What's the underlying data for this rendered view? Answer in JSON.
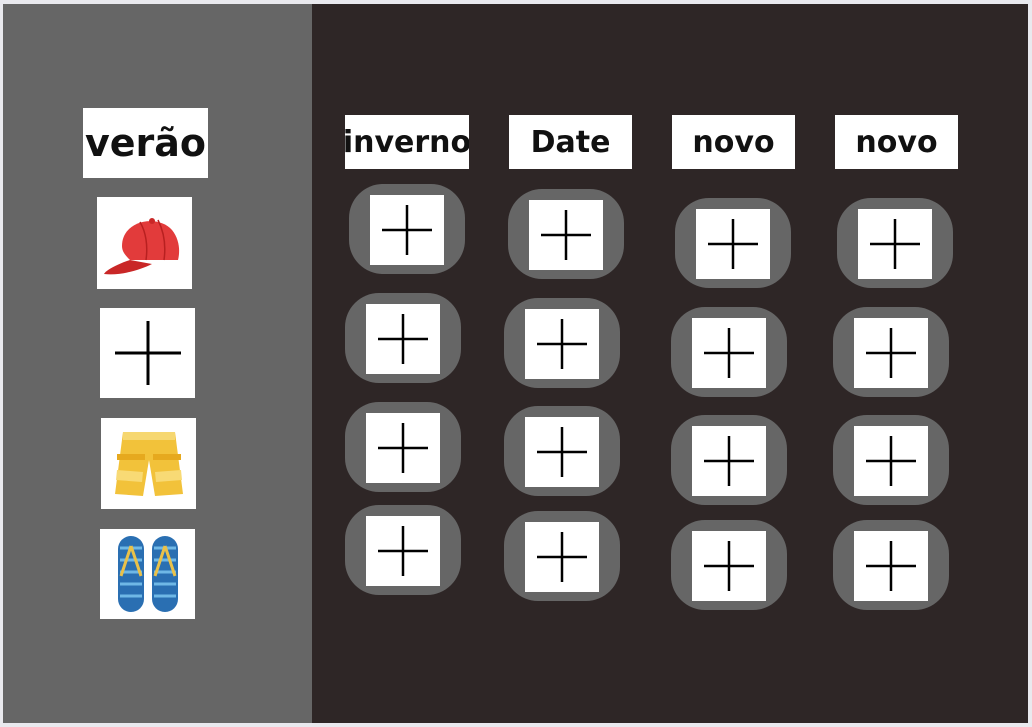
{
  "left_column": {
    "title": "verão",
    "items": [
      {
        "icon": "red-cap-icon"
      },
      {
        "icon": "plus-icon"
      },
      {
        "icon": "yellow-shorts-icon"
      },
      {
        "icon": "flip-flops-icon"
      }
    ]
  },
  "columns": [
    {
      "title": "inverno",
      "slots": 4
    },
    {
      "title": "Date",
      "slots": 4
    },
    {
      "title": "novo",
      "slots": 4
    },
    {
      "title": "novo",
      "slots": 4
    }
  ],
  "colors": {
    "background_dark": "#2e2626",
    "left_panel": "#666666",
    "slot": "#666666",
    "card": "#ffffff"
  }
}
